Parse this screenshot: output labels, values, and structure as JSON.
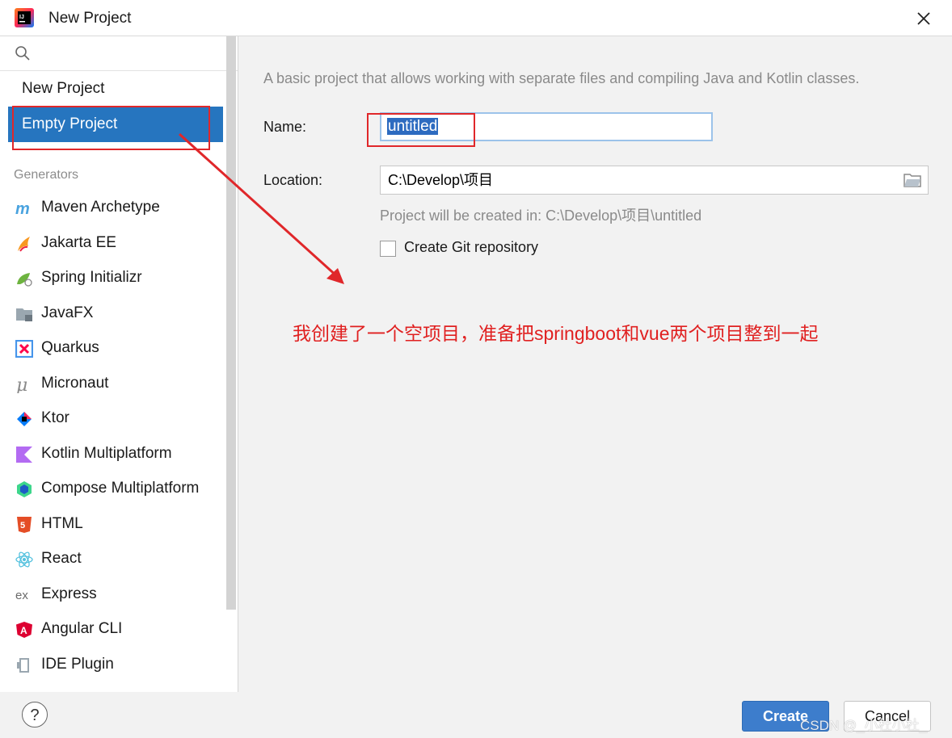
{
  "window": {
    "title": "New Project"
  },
  "sidebar": {
    "search_placeholder": "",
    "items": [
      {
        "label": "New Project"
      },
      {
        "label": "Empty Project",
        "selected": true
      }
    ],
    "generators_title": "Generators",
    "generators": [
      {
        "label": "Maven Archetype",
        "icon": "maven-icon"
      },
      {
        "label": "Jakarta EE",
        "icon": "jakarta-icon"
      },
      {
        "label": "Spring Initializr",
        "icon": "spring-icon"
      },
      {
        "label": "JavaFX",
        "icon": "javafx-icon"
      },
      {
        "label": "Quarkus",
        "icon": "quarkus-icon"
      },
      {
        "label": "Micronaut",
        "icon": "micronaut-icon"
      },
      {
        "label": "Ktor",
        "icon": "ktor-icon"
      },
      {
        "label": "Kotlin Multiplatform",
        "icon": "kotlin-icon"
      },
      {
        "label": "Compose Multiplatform",
        "icon": "compose-icon"
      },
      {
        "label": "HTML",
        "icon": "html5-icon"
      },
      {
        "label": "React",
        "icon": "react-icon"
      },
      {
        "label": "Express",
        "icon": "express-icon"
      },
      {
        "label": "Angular CLI",
        "icon": "angular-icon"
      },
      {
        "label": "IDE Plugin",
        "icon": "plugin-icon"
      }
    ]
  },
  "main": {
    "description": "A basic project that allows working with separate files and compiling Java and Kotlin classes.",
    "name_label": "Name:",
    "name_value": "untitled",
    "location_label": "Location:",
    "location_value": "C:\\Develop\\项目",
    "hint": "Project will be created in: C:\\Develop\\项目\\untitled",
    "git_label": "Create Git repository",
    "git_checked": false,
    "annotation": "我创建了一个空项目，准备把springboot和vue两个项目整到一起"
  },
  "footer": {
    "help_label": "?",
    "create_label": "Create",
    "cancel_label": "Cancel",
    "watermark": "CSDN @_小杜小杜_"
  },
  "colors": {
    "accent": "#2675bf",
    "annotation": "#e0272a"
  }
}
